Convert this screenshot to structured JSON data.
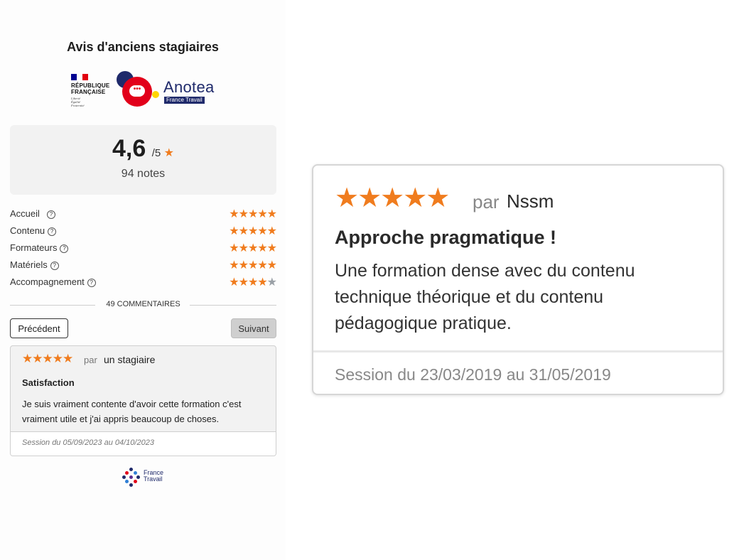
{
  "widget": {
    "title": "Avis d'anciens stagiaires",
    "logos": {
      "republique_line1": "RÉPUBLIQUE",
      "republique_line2": "FRANÇAISE",
      "republique_motto": [
        "Liberté",
        "Égalité",
        "Fraternité"
      ],
      "anotea_name": "Anotea",
      "anotea_sub": "France Travail"
    },
    "score": {
      "value": "4,6",
      "denominator": "/5",
      "star_icon": "star-icon",
      "count_label": "94 notes"
    },
    "criteria": [
      {
        "label": "Accueil",
        "stars": 5
      },
      {
        "label": "Contenu",
        "stars": 5
      },
      {
        "label": "Formateurs",
        "stars": 5
      },
      {
        "label": "Matériels",
        "stars": 5
      },
      {
        "label": "Accompagnement",
        "stars": 4
      }
    ],
    "comments_divider": "49 COMMENTAIRES",
    "pagination": {
      "prev_label": "Précédent",
      "next_label": "Suivant"
    },
    "review": {
      "stars": 5,
      "par_label": "par",
      "author": "un stagiaire",
      "title": "Satisfaction",
      "text": "Je suis vraiment contente d'avoir cette formation c'est vraiment utile et j'ai appris beaucoup de choses.",
      "session": "Session du 05/09/2023 au 04/10/2023"
    },
    "footer_logo": {
      "line1": "France",
      "line2": "Travail"
    }
  },
  "zoomed_review": {
    "stars": 5,
    "par_label": "par",
    "author": "Nssm",
    "title": "Approche pragmatique !",
    "text": "Une formation dense avec du contenu technique théorique et du contenu pédagogique pratique.",
    "session": "Session du 23/03/2019 au 31/05/2019"
  },
  "colors": {
    "star_on": "#f07c1e",
    "star_off": "#9aa0a6",
    "anotea_navy": "#1f2a6b",
    "anotea_red": "#e2001a"
  }
}
